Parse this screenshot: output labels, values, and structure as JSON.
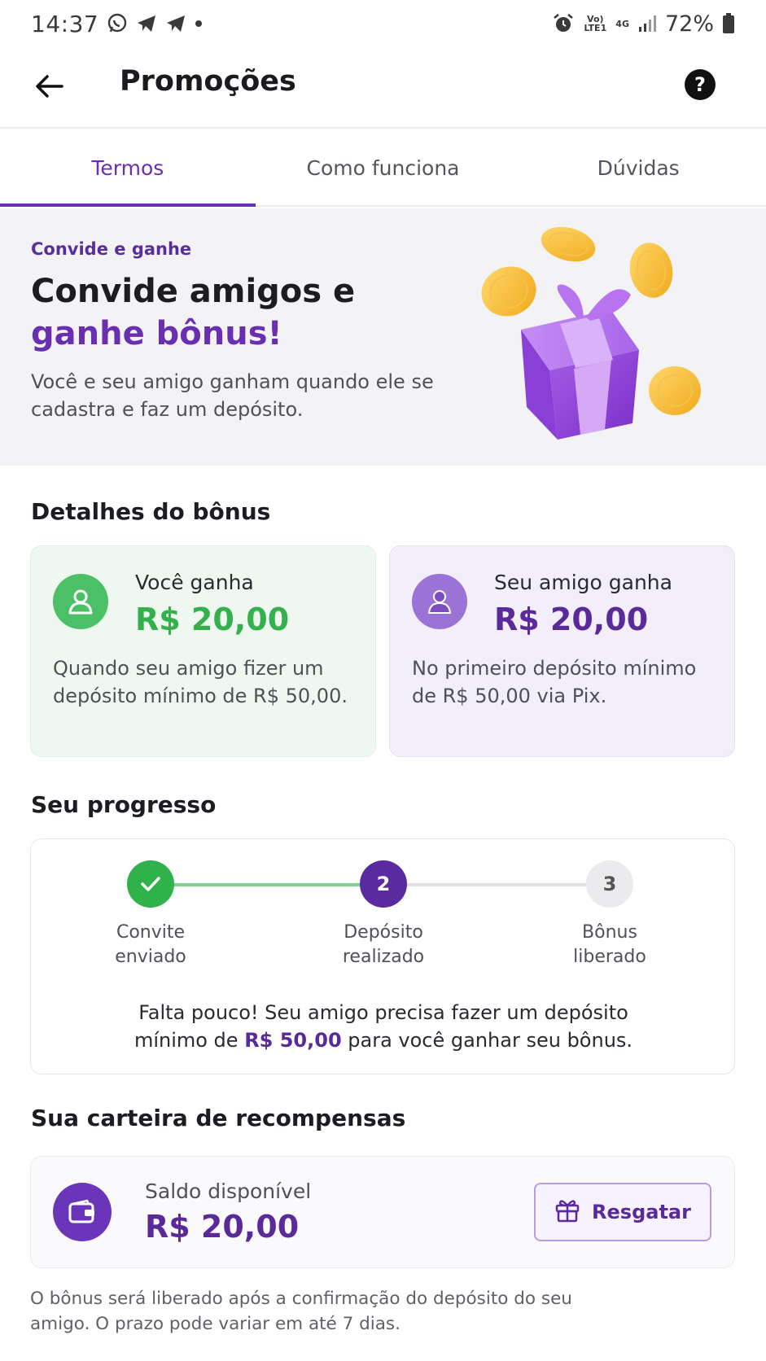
{
  "status_bar": {
    "time": "14:37",
    "battery": "72%",
    "network": "4G",
    "volte": "Vo) LTE1"
  },
  "header": {
    "title": "Promoções",
    "help_label": "?"
  },
  "tabs": [
    {
      "label": "Termos",
      "active": true
    },
    {
      "label": "Como funciona",
      "active": false
    },
    {
      "label": "Dúvidas",
      "active": false
    }
  ],
  "hero": {
    "eyebrow": "Convide e ganhe",
    "title_line1": "Convide amigos e",
    "title_line2": "ganhe bônus!",
    "description": "Você e seu amigo ganham quando ele se cadastra e faz um depósito."
  },
  "bonus": {
    "section_title": "Detalhes do bônus",
    "you": {
      "label": "Você ganha",
      "amount": "R$ 20,00",
      "description": "Quando seu amigo fizer um depósito mínimo de R$ 50,00."
    },
    "friend": {
      "label": "Seu amigo ganha",
      "amount": "R$ 20,00",
      "description": "No primeiro depósito mínimo de R$ 50,00 via Pix."
    }
  },
  "progress": {
    "section_title": "Seu progresso",
    "steps": [
      {
        "number": "1",
        "label_line1": "Convite",
        "label_line2": "enviado",
        "state": "done"
      },
      {
        "number": "2",
        "label_line1": "Depósito",
        "label_line2": "realizado",
        "state": "current"
      },
      {
        "number": "3",
        "label_line1": "Bônus",
        "label_line2": "liberado",
        "state": "pending"
      }
    ],
    "message_part1": "Falta pouco! Seu amigo precisa fazer um depósito",
    "message_part2_prefix": "mínimo de ",
    "message_highlight": "R$ 50,00",
    "message_part2_suffix": " para você ganhar seu bônus."
  },
  "wallet": {
    "section_title": "Sua carteira de recompensas",
    "label": "Saldo disponível",
    "amount": "R$ 20,00",
    "redeem_label": "Resgatar"
  },
  "footnote": "O bônus será liberado após a confirmação do depósito do seu amigo. O prazo pode variar em até 7 dias.",
  "colors": {
    "brand_purple": "#6a2fb1",
    "success_green": "#34b04d"
  }
}
